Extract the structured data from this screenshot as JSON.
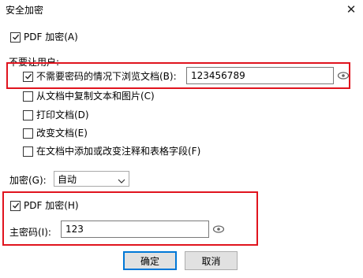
{
  "window": {
    "title": "安全加密"
  },
  "pdf_encrypt_top": {
    "label": "PDF 加密(A)",
    "checked": true
  },
  "user_section": {
    "header": "不要让用户:"
  },
  "options": [
    {
      "label": "不需要密码的情况下浏览文档(B):",
      "checked": true
    },
    {
      "label": "从文档中复制文本和图片(C)",
      "checked": false
    },
    {
      "label": "打印文档(D)",
      "checked": false
    },
    {
      "label": "改变文档(E)",
      "checked": false
    },
    {
      "label": "在文档中添加或改变注释和表格字段(F)",
      "checked": false
    }
  ],
  "view_password": {
    "value": "123456789"
  },
  "encryption": {
    "label": "加密(G):",
    "selected": "自动"
  },
  "pdf_encrypt_bottom": {
    "label": "PDF 加密(H)",
    "checked": true
  },
  "master_password": {
    "label": "主密码(I):",
    "value": "123"
  },
  "buttons": {
    "ok": "确定",
    "cancel": "取消"
  },
  "colors": {
    "highlight": "#e0141e",
    "primary_border": "#0078d7"
  }
}
